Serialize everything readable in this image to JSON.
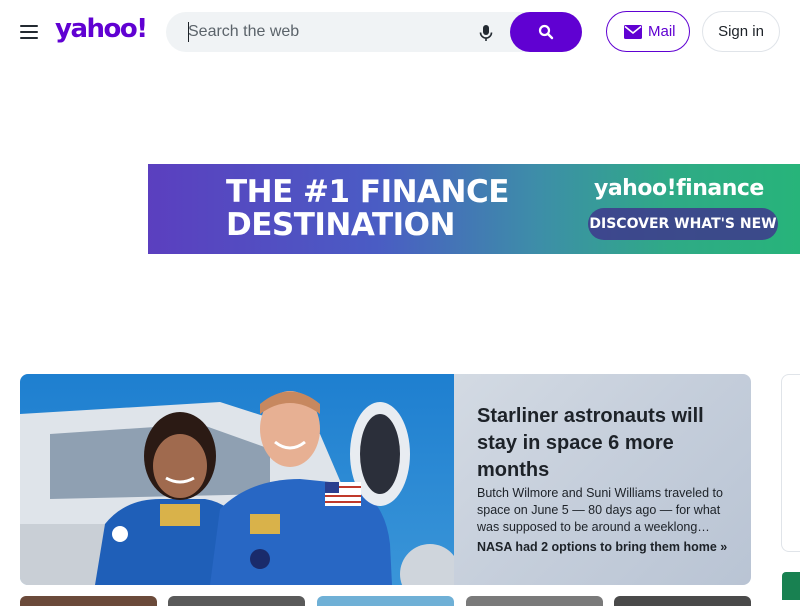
{
  "header": {
    "logo": "yahoo!",
    "search": {
      "placeholder": "Search the web"
    },
    "mail_label": "Mail",
    "signin_label": "Sign in"
  },
  "banner": {
    "headline_line1": "THE #1 FINANCE",
    "headline_line2": "DESTINATION",
    "brand": "yahoo!finance",
    "cta": "DISCOVER WHAT'S NEW"
  },
  "hero": {
    "title": "Starliner astronauts will stay in space 6 more months",
    "summary": "Butch Wilmore and Suni Williams traveled to space on June 5 — 80 days ago — for what was supposed to be around a weeklong…",
    "link": "NASA had 2 options to bring them home »"
  },
  "colors": {
    "brand_purple": "#6001d2",
    "green": "#188151"
  },
  "icons": [
    "menu-icon",
    "microphone-icon",
    "search-icon",
    "mail-icon"
  ]
}
